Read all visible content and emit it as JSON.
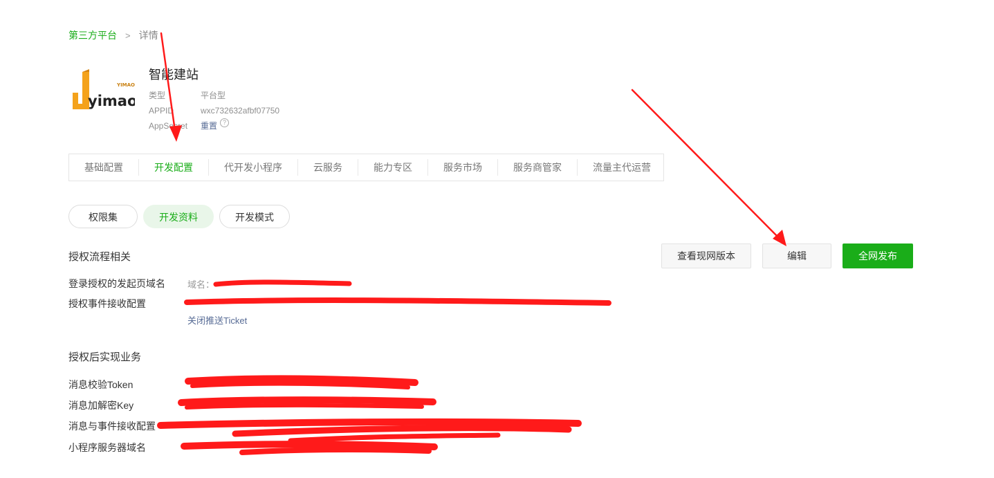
{
  "breadcrumb": {
    "root": "第三方平台",
    "separator": ">",
    "current": "详情"
  },
  "app": {
    "name": "智能建站",
    "logo_text": "yimao",
    "logo_small": "YIMAO",
    "fields": [
      {
        "key": "类型",
        "value": "平台型"
      },
      {
        "key": "APPID",
        "value": "wxc732632afbf07750"
      },
      {
        "key": "AppSecret",
        "value": "重置",
        "help": "?"
      }
    ]
  },
  "tabs": [
    "基础配置",
    "开发配置",
    "代开发小程序",
    "云服务",
    "能力专区",
    "服务市场",
    "服务商管家",
    "流量主代运营"
  ],
  "active_tab": "开发配置",
  "subtabs": [
    "权限集",
    "开发资料",
    "开发模式"
  ],
  "active_subtab": "开发资料",
  "auth_section": {
    "title": "授权流程相关",
    "rows": [
      {
        "label": "登录授权的发起页域名",
        "value": "域名："
      },
      {
        "label": "授权事件接收配置",
        "value": "",
        "link": "关闭推送Ticket"
      }
    ]
  },
  "actions": {
    "view_live": "查看现网版本",
    "edit": "编辑",
    "publish": "全网发布"
  },
  "business_section": {
    "title": "授权后实现业务",
    "rows": [
      {
        "label": "消息校验Token"
      },
      {
        "label": "消息加解密Key"
      },
      {
        "label": "消息与事件接收配置"
      },
      {
        "label": "小程序服务器域名"
      }
    ]
  },
  "colors": {
    "accent": "#1aad19",
    "link": "#576b95",
    "annotation": "#ff1a1a"
  }
}
